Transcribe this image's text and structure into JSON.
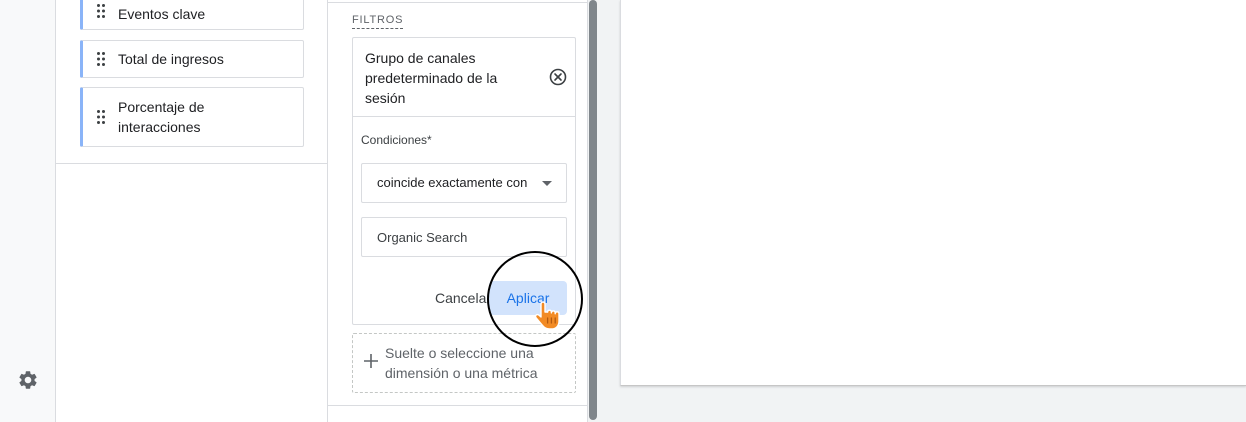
{
  "left_rail": {
    "settings_icon": "gear-icon"
  },
  "variables": {
    "metrics": [
      {
        "label": "Eventos clave"
      },
      {
        "label": "Total de ingresos"
      },
      {
        "label": "Porcentaje de interacciones"
      }
    ]
  },
  "filters": {
    "title": "FILTROS",
    "dimension": "Grupo de canales predeterminado de la sesión",
    "conditions_label": "Condiciones*",
    "match_type": "coincide exactamente con",
    "value": "Organic Search",
    "cancel_label": "Cancelar",
    "apply_label": "Aplicar",
    "drop_zone_text": "Suelte o seleccione una dimensión o una métrica"
  },
  "colors": {
    "accent_blue": "#1a73e8",
    "apply_bg": "#d2e3fc",
    "metric_bar": "#8ab4f8",
    "cursor_orange": "#f28b25"
  }
}
